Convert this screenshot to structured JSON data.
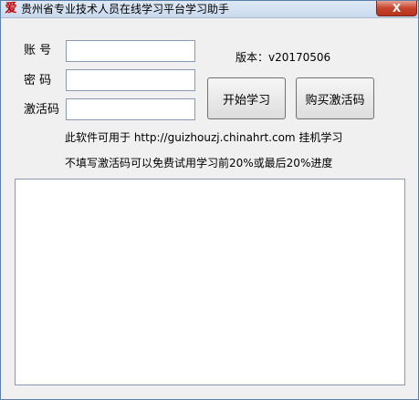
{
  "window": {
    "title": "贵州省专业技术人员在线学习平台学习助手",
    "icon_glyph": "爱",
    "close_glyph": "X"
  },
  "form": {
    "account_label": "账  号",
    "password_label": "密  码",
    "activation_label": "激活码",
    "account_value": "",
    "password_value": "",
    "activation_value": ""
  },
  "version_text": "版本：v20170506",
  "buttons": {
    "start_study": "开始学习",
    "buy_code": "购买激活码"
  },
  "info": {
    "line1": "此软件可用于 http://guizhouzj.chinahrt.com 挂机学习",
    "line2": "不填写激活码可以免费试用学习前20%或最后20%进度"
  },
  "log": {
    "value": ""
  },
  "colors": {
    "close_button": "#c7432c",
    "window_bg": "#f0f0f0"
  }
}
